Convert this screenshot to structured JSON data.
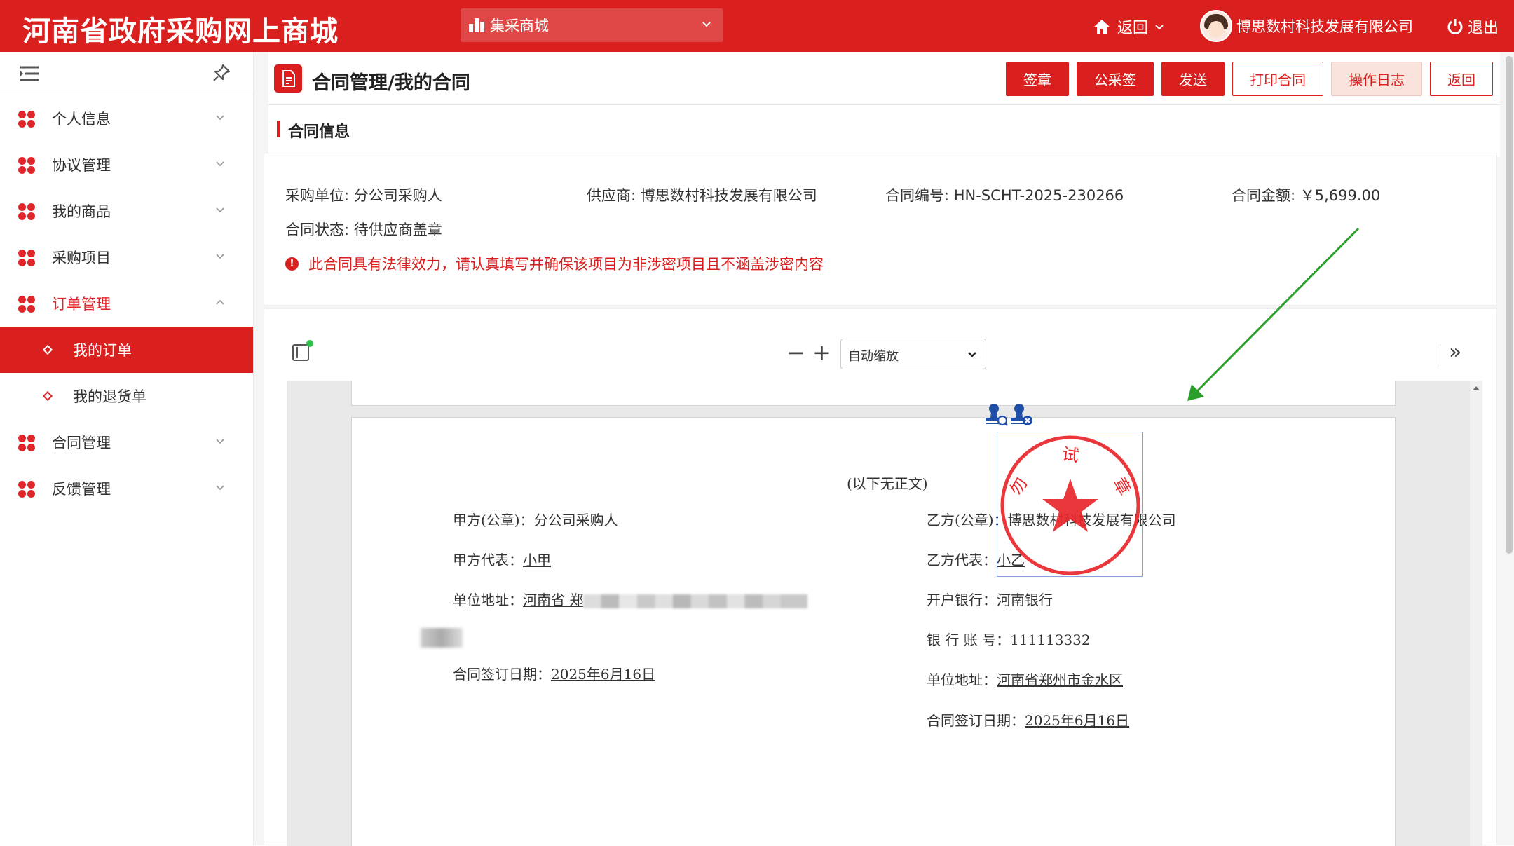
{
  "header": {
    "site_title": "河南省政府采购网上商城",
    "mall_select": "集采商城",
    "back_label": "返回",
    "user_name": "博思数村科技发展有限公司",
    "logout_label": "退出",
    "brand_color": "#d9201f"
  },
  "sidebar": {
    "items": [
      {
        "label": "个人信息",
        "expanded": false
      },
      {
        "label": "协议管理",
        "expanded": false
      },
      {
        "label": "我的商品",
        "expanded": false
      },
      {
        "label": "采购项目",
        "expanded": false
      },
      {
        "label": "订单管理",
        "expanded": true
      },
      {
        "label": "合同管理",
        "expanded": false
      },
      {
        "label": "反馈管理",
        "expanded": false
      }
    ],
    "sub_items": [
      {
        "label": "我的订单",
        "active": true
      },
      {
        "label": "我的退货单",
        "active": false
      }
    ]
  },
  "page": {
    "title": "合同管理/我的合同",
    "buttons": [
      "签章",
      "公采签",
      "发送",
      "打印合同",
      "操作日志",
      "返回"
    ],
    "section_title": "合同信息"
  },
  "contract": {
    "buyer": "采购单位: 分公司采购人",
    "supplier": "供应商: 博思数村科技发展有限公司",
    "number": "合同编号: HN-SCHT-2025-230266",
    "amount": "合同金额: ￥5,699.00",
    "status": "合同状态: 待供应商盖章",
    "warning": "此合同具有法律效力，请认真填写并确保该项目为非涉密项目且不涵盖涉密内容",
    "warning_icon": "!"
  },
  "viewer": {
    "zoom_minus": "−",
    "zoom_plus": "+",
    "zoom_value": "自动缩放",
    "more": "»"
  },
  "document": {
    "end_note": "(以下无正文)",
    "party_a_label": "甲方(公章)：",
    "party_a_value": "分公司采购人",
    "party_a_rep_label": "甲方代表：",
    "party_a_rep_value": "小甲",
    "party_a_addr_label": "单位地址：",
    "party_a_addr_value": "河南省 郑",
    "party_a_date_label": "合同签订日期：",
    "party_a_date_value": "2025年6月16日",
    "party_b_label": "乙方(公章)：",
    "party_b_value": "博思数村科技发展有限公司",
    "party_b_rep_label": "乙方代表：",
    "party_b_rep_value": "小乙",
    "party_b_bank_label": "开户银行：",
    "party_b_bank_value": "河南银行",
    "party_b_account_label": "银 行 账 号：",
    "party_b_account_value": "111113332",
    "party_b_addr_label": "单位地址：",
    "party_b_addr_value": "河南省郑州市金水区",
    "party_b_date_label": "合同签订日期：",
    "party_b_date_value": "2025年6月16日",
    "seal_top_text": "试",
    "seal_left_text": "勿",
    "seal_right_text": "章",
    "seal_color": "#e8262a"
  },
  "annotation": {
    "arrow_color": "#2aa02a"
  }
}
